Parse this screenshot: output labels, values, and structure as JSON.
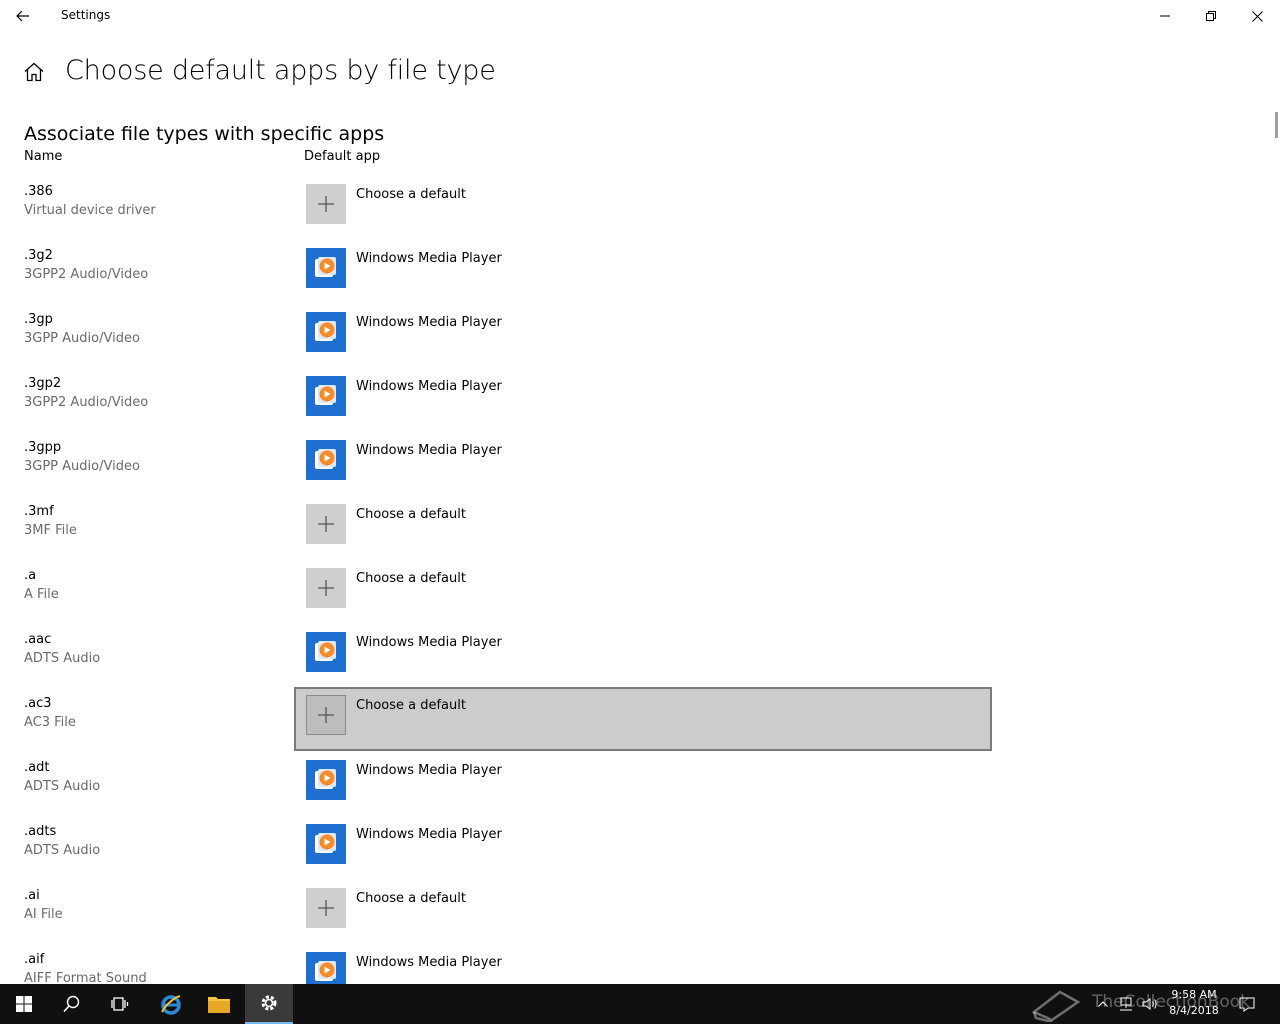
{
  "window": {
    "title": "Settings",
    "back_label": "Back",
    "minimize_label": "Minimize",
    "restore_label": "Restore",
    "close_label": "Close"
  },
  "page": {
    "title": "Choose default apps by file type",
    "section_title": "Associate file types with specific apps",
    "columns": {
      "name": "Name",
      "app": "Default app"
    }
  },
  "rows": [
    {
      "ext": ".386",
      "desc": "Virtual device driver",
      "app": "Choose a default",
      "icon": "plus-icon"
    },
    {
      "ext": ".3g2",
      "desc": "3GPP2 Audio/Video",
      "app": "Windows Media Player",
      "icon": "windows-media-player-icon"
    },
    {
      "ext": ".3gp",
      "desc": "3GPP Audio/Video",
      "app": "Windows Media Player",
      "icon": "windows-media-player-icon"
    },
    {
      "ext": ".3gp2",
      "desc": "3GPP2 Audio/Video",
      "app": "Windows Media Player",
      "icon": "windows-media-player-icon"
    },
    {
      "ext": ".3gpp",
      "desc": "3GPP Audio/Video",
      "app": "Windows Media Player",
      "icon": "windows-media-player-icon"
    },
    {
      "ext": ".3mf",
      "desc": "3MF File",
      "app": "Choose a default",
      "icon": "plus-icon"
    },
    {
      "ext": ".a",
      "desc": "A File",
      "app": "Choose a default",
      "icon": "plus-icon"
    },
    {
      "ext": ".aac",
      "desc": "ADTS Audio",
      "app": "Windows Media Player",
      "icon": "windows-media-player-icon"
    },
    {
      "ext": ".ac3",
      "desc": "AC3 File",
      "app": "Choose a default",
      "icon": "plus-icon",
      "focused": true
    },
    {
      "ext": ".adt",
      "desc": "ADTS Audio",
      "app": "Windows Media Player",
      "icon": "windows-media-player-icon"
    },
    {
      "ext": ".adts",
      "desc": "ADTS Audio",
      "app": "Windows Media Player",
      "icon": "windows-media-player-icon"
    },
    {
      "ext": ".ai",
      "desc": "AI File",
      "app": "Choose a default",
      "icon": "plus-icon"
    },
    {
      "ext": ".aif",
      "desc": "AIFF Format Sound",
      "app": "Windows Media Player",
      "icon": "windows-media-player-icon"
    }
  ],
  "taskbar": {
    "time": "9:58 AM",
    "date": "8/4/2018",
    "watermark": "TheCollectionBook"
  },
  "colors": {
    "accent_blue": "#1e6fd0",
    "wmp_orange": "#f28c28",
    "focus_bg": "#cccccc",
    "taskbar_bg": "#101010"
  }
}
